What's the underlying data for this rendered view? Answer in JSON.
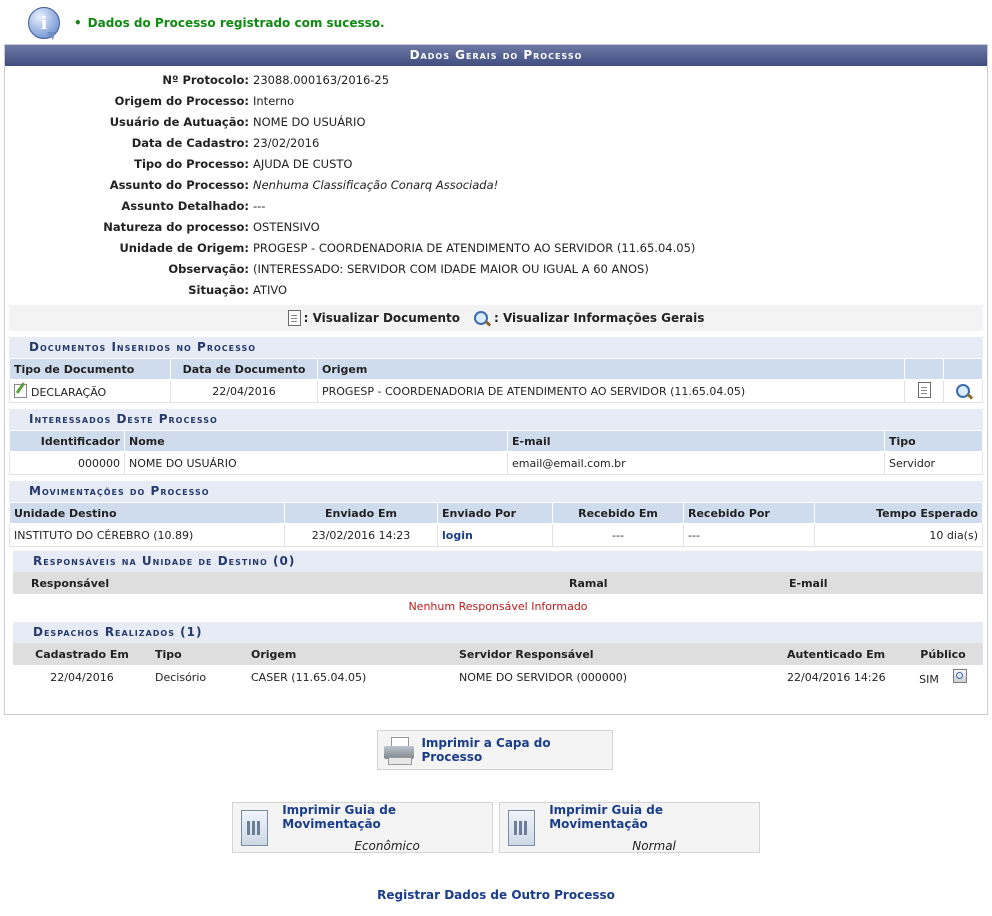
{
  "message": {
    "text": "Dados do Processo registrado com sucesso."
  },
  "header": {
    "title": "Dados Gerais do Processo"
  },
  "fields": [
    {
      "label": "Nº Protocolo:",
      "value": "23088.000163/2016-25"
    },
    {
      "label": "Origem do Processo:",
      "value": "Interno"
    },
    {
      "label": "Usuário de Autuação:",
      "value": "NOME DO USUÁRIO"
    },
    {
      "label": "Data de Cadastro:",
      "value": "23/02/2016"
    },
    {
      "label": "Tipo do Processo:",
      "value": "AJUDA DE CUSTO"
    },
    {
      "label": "Assunto do Processo:",
      "value": "Nenhuma Classificação Conarq Associada!"
    },
    {
      "label": "Assunto Detalhado:",
      "value": "---"
    },
    {
      "label": "Natureza do processo:",
      "value": "OSTENSIVO"
    },
    {
      "label": "Unidade de Origem:",
      "value": "PROGESP - COORDENADORIA DE ATENDIMENTO AO SERVIDOR (11.65.04.05)"
    },
    {
      "label": "Observação:",
      "value": "(INTERESSADO: SERVIDOR COM IDADE MAIOR OU IGUAL A 60 ANOS)"
    },
    {
      "label": "Situação:",
      "value": "ATIVO"
    }
  ],
  "links": {
    "view_document": ": Visualizar Documento",
    "view_info": ": Visualizar Informações Gerais"
  },
  "documents": {
    "title": "Documentos Inseridos no Processo",
    "headers": [
      "Tipo de Documento",
      "Data de Documento",
      "Origem"
    ],
    "row": {
      "type": "DECLARAÇÃO",
      "date": "22/04/2016",
      "origin": "PROGESP - COORDENADORIA DE ATENDIMENTO AO SERVIDOR (11.65.04.05)"
    }
  },
  "interested": {
    "title": "Interessados Deste Processo",
    "headers": [
      "Identificador",
      "Nome",
      "E-mail",
      "Tipo"
    ],
    "row": {
      "id": "000000",
      "name": "NOME DO USUÁRIO",
      "email": "email@email.com.br",
      "type": "Servidor"
    }
  },
  "movements": {
    "title": "Movimentações do Processo",
    "headers": [
      "Unidade Destino",
      "Enviado Em",
      "Enviado Por",
      "Recebido Em",
      "Recebido Por",
      "Tempo Esperado"
    ],
    "row": {
      "unit": "INSTITUTO DO CÉREBRO (10.89)",
      "sent_at": "23/02/2016 14:23",
      "sent_by": "login",
      "received_at": "---",
      "received_by": "---",
      "expected": "10 dia(s)"
    }
  },
  "responsibles": {
    "title": "Responsáveis na Unidade de Destino (0)",
    "headers": [
      "Responsável",
      "Ramal",
      "E-mail"
    ],
    "empty": "Nenhum Responsável Informado"
  },
  "dispatches": {
    "title": "Despachos Realizados (1)",
    "headers": [
      "Cadastrado Em",
      "Tipo",
      "Origem",
      "Servidor Responsável",
      "Autenticado Em",
      "Público"
    ],
    "row": {
      "created": "22/04/2016",
      "type": "Decisório",
      "origin": "CASER (11.65.04.05)",
      "server": "NOME DO SERVIDOR (000000)",
      "auth": "22/04/2016 14:26",
      "public": "SIM"
    }
  },
  "actions": {
    "print_cover": "Imprimir a Capa do Processo",
    "print_guide": "Imprimir Guia de Movimentação",
    "economic": "Econômico",
    "normal": "Normal",
    "register_other": "Registrar Dados de Outro Processo"
  }
}
